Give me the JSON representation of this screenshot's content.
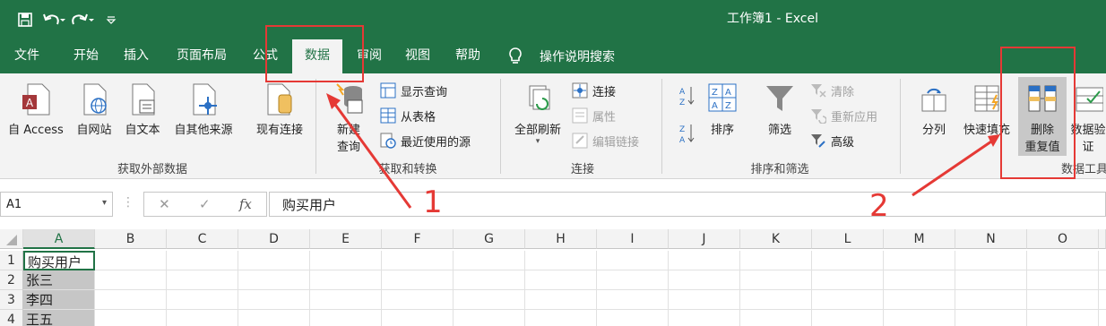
{
  "window": {
    "title": "工作簿1  -  Excel"
  },
  "qat": {
    "save_icon": "save-icon",
    "undo_icon": "undo-icon",
    "redo_icon": "redo-icon",
    "customize_icon": "customize-qat-icon"
  },
  "tabs": [
    "文件",
    "开始",
    "插入",
    "页面布局",
    "公式",
    "数据",
    "审阅",
    "视图",
    "帮助"
  ],
  "active_tab": "数据",
  "tell_me": "操作说明搜索",
  "ribbon": {
    "get_external": {
      "buttons": [
        "自 Access",
        "自网站",
        "自文本",
        "自其他来源",
        "现有连接"
      ],
      "label": "获取外部数据"
    },
    "get_transform": {
      "new_query_line1": "新建",
      "new_query_line2": "查询",
      "small": [
        "显示查询",
        "从表格",
        "最近使用的源"
      ],
      "label": "获取和转换"
    },
    "connections": {
      "refresh_all": "全部刷新",
      "small": [
        "连接",
        "属性",
        "编辑链接"
      ],
      "label": "连接"
    },
    "sort_filter": {
      "sort": "排序",
      "filter": "筛选",
      "small": [
        "清除",
        "重新应用",
        "高级"
      ],
      "label": "排序和筛选"
    },
    "data_tools": {
      "split": "分列",
      "flash_fill": "快速填充",
      "remove_dup_line1": "删除",
      "remove_dup_line2": "重复值",
      "validation_line1": "数据验",
      "validation_line2": "证",
      "label": "数据工具"
    }
  },
  "formula_bar": {
    "name_box": "A1",
    "cancel": "✕",
    "enter": "✓",
    "fx": "fx",
    "content": "购买用户"
  },
  "columns": [
    "A",
    "B",
    "C",
    "D",
    "E",
    "F",
    "G",
    "H",
    "I",
    "J",
    "K",
    "L",
    "M",
    "N",
    "O"
  ],
  "rows": [
    "1",
    "2",
    "3",
    "4"
  ],
  "cells": {
    "A1": "购买用户",
    "A2": "张三",
    "A3": "李四",
    "A4": "王五"
  },
  "annotations": {
    "marker1": "1",
    "marker2": "2",
    "color": "#e53935"
  },
  "colors": {
    "brand": "#217346",
    "ribbon_bg": "#f3f3f3"
  }
}
